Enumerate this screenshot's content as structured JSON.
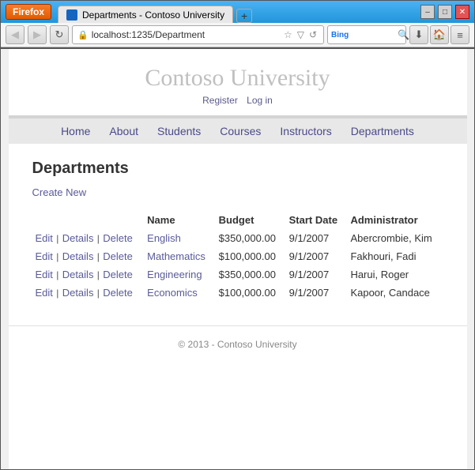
{
  "window": {
    "title": "Departments - Contoso University",
    "firefox_label": "Firefox",
    "new_tab_symbol": "+",
    "controls": {
      "minimize": "–",
      "maximize": "□",
      "close": "✕"
    }
  },
  "navbar": {
    "back": "◀",
    "forward": "▶",
    "refresh": "↻",
    "address": "localhost:1235/Department",
    "search_label": "Bing",
    "search_placeholder": ""
  },
  "site": {
    "title": "Contoso University",
    "auth_links": {
      "register": "Register",
      "login": "Log in"
    },
    "nav": [
      "Home",
      "About",
      "Students",
      "Courses",
      "Instructors",
      "Departments"
    ]
  },
  "page": {
    "heading": "Departments",
    "create_new_label": "Create New",
    "table": {
      "headers": [
        "Name",
        "Budget",
        "Start Date",
        "Administrator"
      ],
      "rows": [
        {
          "actions": [
            "Edit",
            "Details",
            "Delete"
          ],
          "name": "English",
          "budget": "$350,000.00",
          "start_date": "9/1/2007",
          "administrator": "Abercrombie, Kim"
        },
        {
          "actions": [
            "Edit",
            "Details",
            "Delete"
          ],
          "name": "Mathematics",
          "budget": "$100,000.00",
          "start_date": "9/1/2007",
          "administrator": "Fakhouri, Fadi"
        },
        {
          "actions": [
            "Edit",
            "Details",
            "Delete"
          ],
          "name": "Engineering",
          "budget": "$350,000.00",
          "start_date": "9/1/2007",
          "administrator": "Harui, Roger"
        },
        {
          "actions": [
            "Edit",
            "Details",
            "Delete"
          ],
          "name": "Economics",
          "budget": "$100,000.00",
          "start_date": "9/1/2007",
          "administrator": "Kapoor, Candace"
        }
      ]
    }
  },
  "footer": {
    "text": "© 2013 - Contoso University"
  }
}
